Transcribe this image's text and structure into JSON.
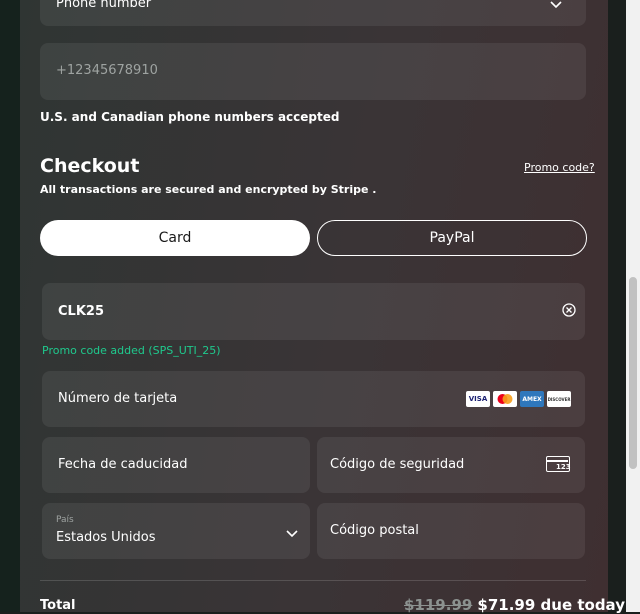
{
  "phone": {
    "country_label": "Phone number",
    "placeholder": "+12345678910",
    "note": "U.S. and Canadian phone numbers accepted"
  },
  "checkout": {
    "title": "Checkout",
    "promo_link": "Promo code?",
    "secure_note_prefix": "All transactions are secured and encrypted by ",
    "secure_brand": "Stripe",
    "secure_suffix": " ."
  },
  "payment_tabs": [
    {
      "label": "Card",
      "selected": true
    },
    {
      "label": "PayPal",
      "selected": false
    }
  ],
  "promo": {
    "value": "CLK25",
    "status": "Promo code added (SPS_UTI_25)",
    "status_color": "#1fc98d"
  },
  "card_form": {
    "card_number_label": "Número de tarjeta",
    "expiry_label": "Fecha de caducidad",
    "cvc_label": "Código de seguridad",
    "cvc_icon_text": "123",
    "country_small_label": "País",
    "country_value": "Estados Unidos",
    "postal_label": "Código postal",
    "brands": [
      "VISA",
      "mastercard",
      "AMEX",
      "DISCOVER"
    ]
  },
  "total": {
    "label": "Total",
    "old_price": "$119.99",
    "new_price": "$71.99 due today"
  }
}
